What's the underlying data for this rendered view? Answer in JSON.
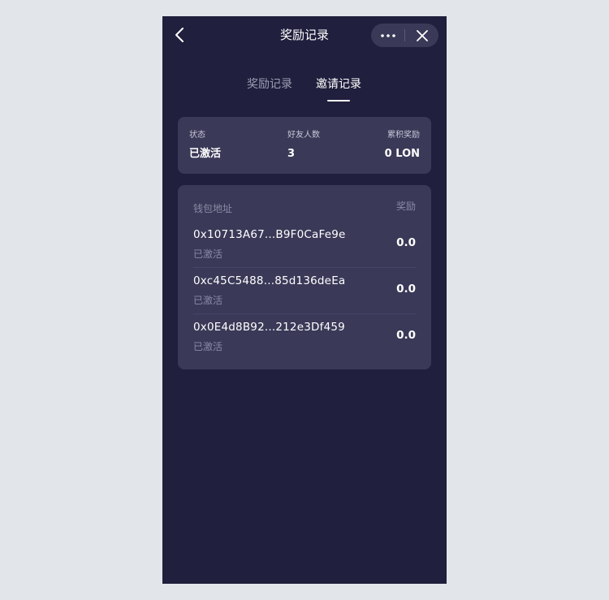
{
  "navbar": {
    "title": "奖励记录",
    "back_icon": "chevron-left-icon",
    "more_icon": "more-horizontal-icon",
    "close_icon": "close-icon"
  },
  "tabs": [
    {
      "label": "奖励记录",
      "active": false
    },
    {
      "label": "邀请记录",
      "active": true
    }
  ],
  "summary": {
    "status_label": "状态",
    "status_value": "已激活",
    "friends_label": "好友人数",
    "friends_value": "3",
    "reward_label": "累积奖励",
    "reward_value": "0 LON"
  },
  "list": {
    "header_address": "钱包地址",
    "header_reward": "奖励",
    "rows": [
      {
        "address": "0x10713A67...B9F0CaFe9e",
        "status": "已激活",
        "reward": "0.0"
      },
      {
        "address": "0xc45C5488...85d136deEa",
        "status": "已激活",
        "reward": "0.0"
      },
      {
        "address": "0x0E4d8B92...212e3Df459",
        "status": "已激活",
        "reward": "0.0"
      }
    ]
  },
  "colors": {
    "background": "#201f3d",
    "card": "#3a3958",
    "muted_text": "#8b8aa3",
    "outer_bg": "#e2e6ea"
  }
}
